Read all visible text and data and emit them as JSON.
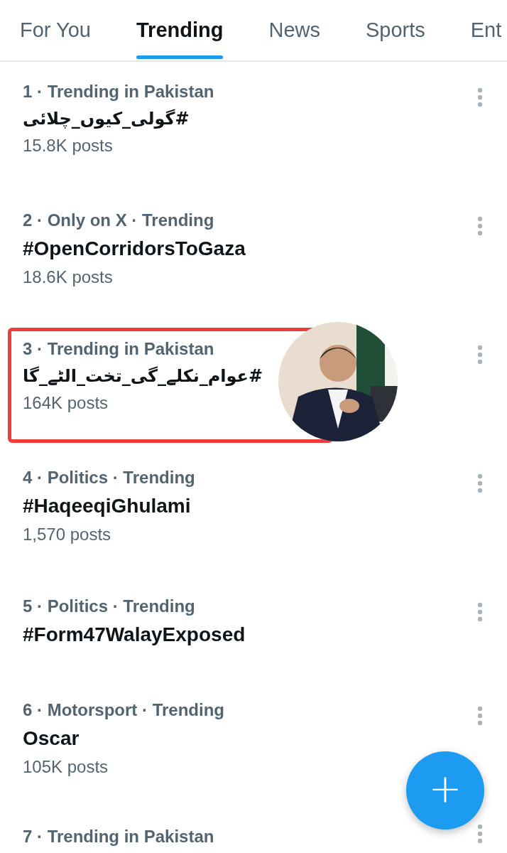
{
  "tabs": [
    {
      "label": "For You",
      "selected": false
    },
    {
      "label": "Trending",
      "selected": true
    },
    {
      "label": "News",
      "selected": false
    },
    {
      "label": "Sports",
      "selected": false
    },
    {
      "label": "Ent",
      "selected": false
    }
  ],
  "trends": [
    {
      "context": "1 · Trending in Pakistan",
      "topic": "#گولی_کیوں_چلائی",
      "posts": "15.8K posts",
      "highlighted": false
    },
    {
      "context": "2 · Only on X · Trending",
      "topic": "#OpenCorridorsToGaza",
      "posts": "18.6K posts",
      "highlighted": false
    },
    {
      "context": "3 · Trending in Pakistan",
      "topic": "#عوام_نکلے_گی_تخت_الٹے_گا",
      "posts": "164K posts",
      "highlighted": true
    },
    {
      "context": "4 · Politics · Trending",
      "topic": "#HaqeeqiGhulami",
      "posts": "1,570 posts",
      "highlighted": false
    },
    {
      "context": "5 · Politics · Trending",
      "topic": "#Form47WalayExposed",
      "highlighted": false
    },
    {
      "context": "6 · Motorsport · Trending",
      "topic": "Oscar",
      "posts": "105K posts",
      "highlighted": false
    },
    {
      "context": "7 · Trending in Pakistan",
      "highlighted": false
    }
  ],
  "compose_button": {
    "label": "+"
  }
}
